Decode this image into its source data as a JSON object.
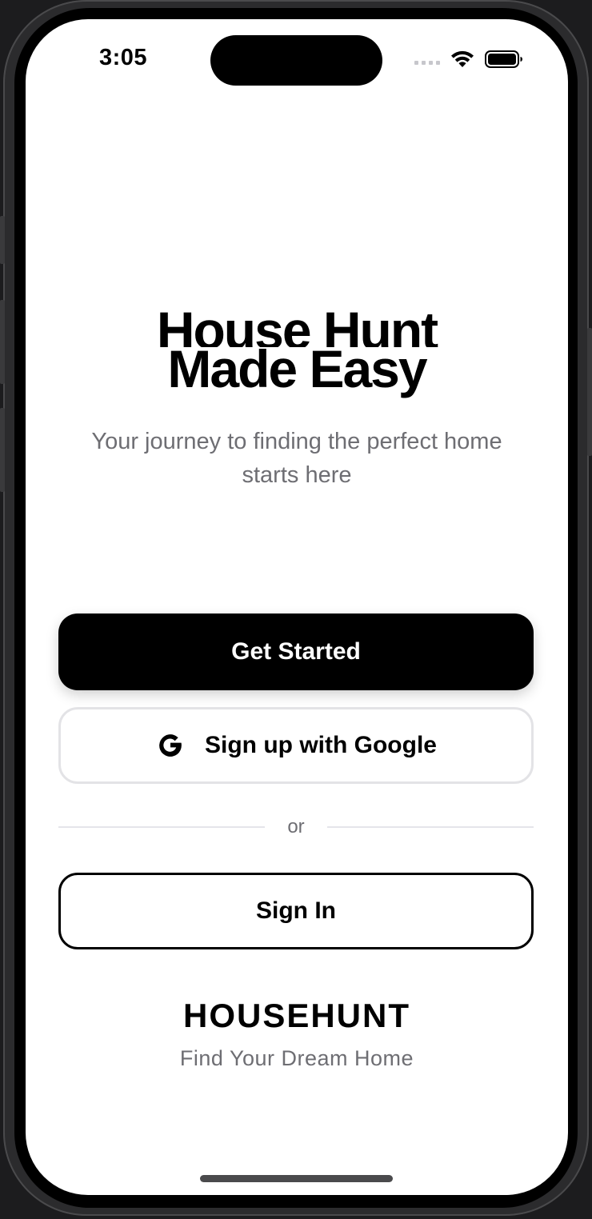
{
  "status_bar": {
    "time": "3:05",
    "icons": [
      "cellular-signal-icon",
      "wifi-icon",
      "battery-icon"
    ]
  },
  "hero": {
    "title_line_1": "House Hunt",
    "title_line_2": "Made Easy",
    "subtitle": "Your journey to finding the perfect home starts here"
  },
  "actions": {
    "get_started_label": "Get Started",
    "google_label": "Sign up with Google",
    "google_icon": "google-icon",
    "divider_text": "or",
    "sign_in_label": "Sign In"
  },
  "footer": {
    "brand": "HOUSEHUNT",
    "tagline": "Find Your Dream Home"
  },
  "colors": {
    "primary": "#000000",
    "background": "#ffffff",
    "muted_text": "#6e6e73",
    "border_light": "#e3e3e6"
  }
}
